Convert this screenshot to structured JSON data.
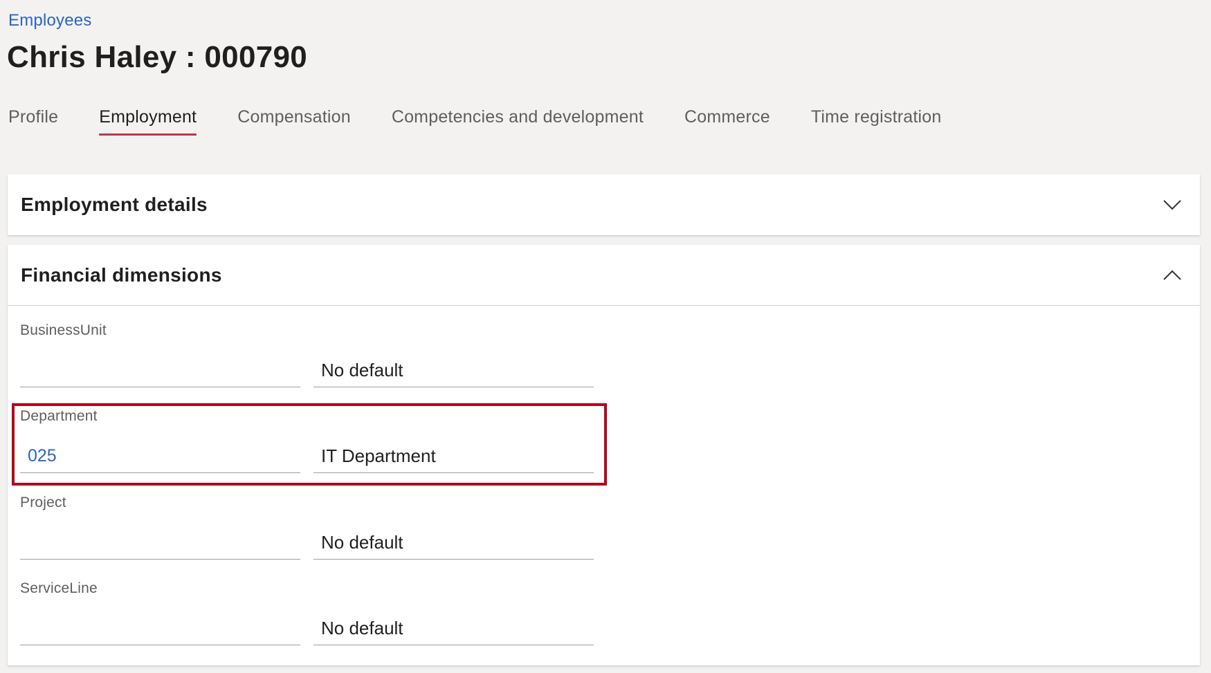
{
  "breadcrumb": "Employees",
  "page_title": "Chris Haley : 000790",
  "tabs": [
    {
      "label": "Profile",
      "active": false
    },
    {
      "label": "Employment",
      "active": true
    },
    {
      "label": "Compensation",
      "active": false
    },
    {
      "label": "Competencies and development",
      "active": false
    },
    {
      "label": "Commerce",
      "active": false
    },
    {
      "label": "Time registration",
      "active": false
    }
  ],
  "sections": {
    "employment_details": {
      "title": "Employment details",
      "expanded": false,
      "chevron": "chevron-down-icon"
    },
    "financial_dimensions": {
      "title": "Financial dimensions",
      "expanded": true,
      "chevron": "chevron-up-icon"
    }
  },
  "dimensions": [
    {
      "label": "BusinessUnit",
      "code": "",
      "description": "No default"
    },
    {
      "label": "Department",
      "code": "025",
      "description": "IT Department",
      "highlighted": true
    },
    {
      "label": "Project",
      "code": "",
      "description": "No default"
    },
    {
      "label": "ServiceLine",
      "code": "",
      "description": "No default"
    }
  ],
  "colors": {
    "link": "#2b64c6",
    "active_tab_underline": "#c4314b",
    "highlight_border": "#b2081c",
    "background": "#f3f2f1"
  }
}
